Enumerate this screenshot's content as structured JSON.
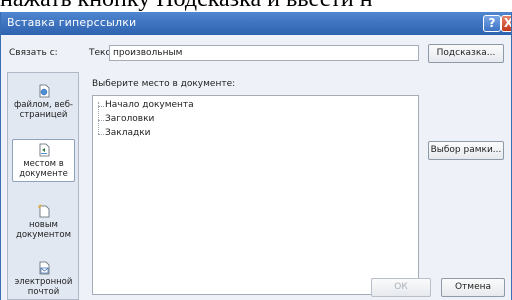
{
  "background_text": "нажать кнопку Подсказка и ввести н",
  "window": {
    "title": "Вставка гиперссылки",
    "help_label": "?",
    "close_label": "X"
  },
  "link_to": {
    "label": "Связать с:"
  },
  "text_field": {
    "label": "Текст:",
    "value": "произвольным"
  },
  "buttons": {
    "hint": "Подсказка...",
    "frame_select": "Выбор рамки...",
    "ok": "ОК",
    "cancel": "Отмена"
  },
  "place_label": "Выберите место в документе:",
  "tree": [
    "Начало документа",
    "Заголовки",
    "Закладки"
  ],
  "sidebar": {
    "items": [
      {
        "label": "файлом, веб-страницей",
        "icon": "web-page-icon",
        "selected": false
      },
      {
        "label": "местом в документе",
        "icon": "place-in-document-icon",
        "selected": true
      },
      {
        "label": "новым документом",
        "icon": "new-document-icon",
        "selected": false
      },
      {
        "label": "электронной почтой",
        "icon": "email-icon",
        "selected": false
      }
    ]
  },
  "colors": {
    "titlebar": "#2e62b0",
    "dialog_bg": "#eef2f8",
    "close_button": "#c2361b"
  }
}
